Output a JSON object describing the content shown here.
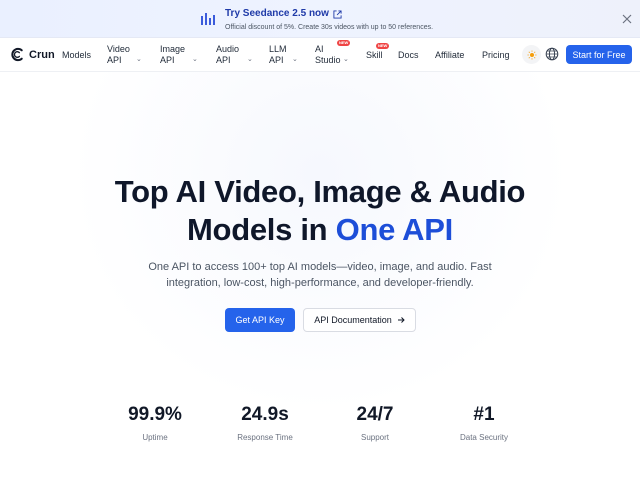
{
  "banner": {
    "title": "Try Seedance 2.5 now",
    "subtitle": "Official discount of 5%. Create 30s videos with up to 50 references.",
    "icons": {
      "chart": "bar-chart-icon",
      "external": "external-link-icon",
      "close": "close-icon"
    }
  },
  "nav": {
    "logo_text": "Crun",
    "items": [
      {
        "line1": "Models",
        "line2": ""
      },
      {
        "line1": "Video",
        "line2": "API"
      },
      {
        "line1": "Image",
        "line2": "API"
      },
      {
        "line1": "Audio",
        "line2": "API"
      },
      {
        "line1": "LLM",
        "line2": "API"
      },
      {
        "line1": "AI",
        "line2": "Studio",
        "badge": "NEW"
      },
      {
        "line1": "Skill",
        "line2": "",
        "badge": "NEW"
      },
      {
        "line1": "Docs",
        "line2": ""
      },
      {
        "line1": "Affiliate",
        "line2": ""
      },
      {
        "line1": "Pricing",
        "line2": ""
      }
    ],
    "cta": "Start for Free"
  },
  "hero": {
    "title_line1": "Top AI Video, Image & Audio",
    "title_line2_prefix": "Models in",
    "title_accent": "One API",
    "subtitle": "One API to access 100+ top AI models—video, image, and audio. Fast integration, low-cost, high-performance, and developer-friendly.",
    "primary_button": "Get API Key",
    "secondary_button": "API Documentation"
  },
  "stats": [
    {
      "value": "99.9%",
      "label": "Uptime"
    },
    {
      "value": "24.9s",
      "label": "Response Time"
    },
    {
      "value": "24/7",
      "label": "Support"
    },
    {
      "value": "#1",
      "label": "Data Security"
    }
  ],
  "colors": {
    "accent": "#2563eb",
    "accent_text": "#1d4ed8",
    "badge": "#ef4444",
    "banner_title": "#1f3aa8"
  }
}
